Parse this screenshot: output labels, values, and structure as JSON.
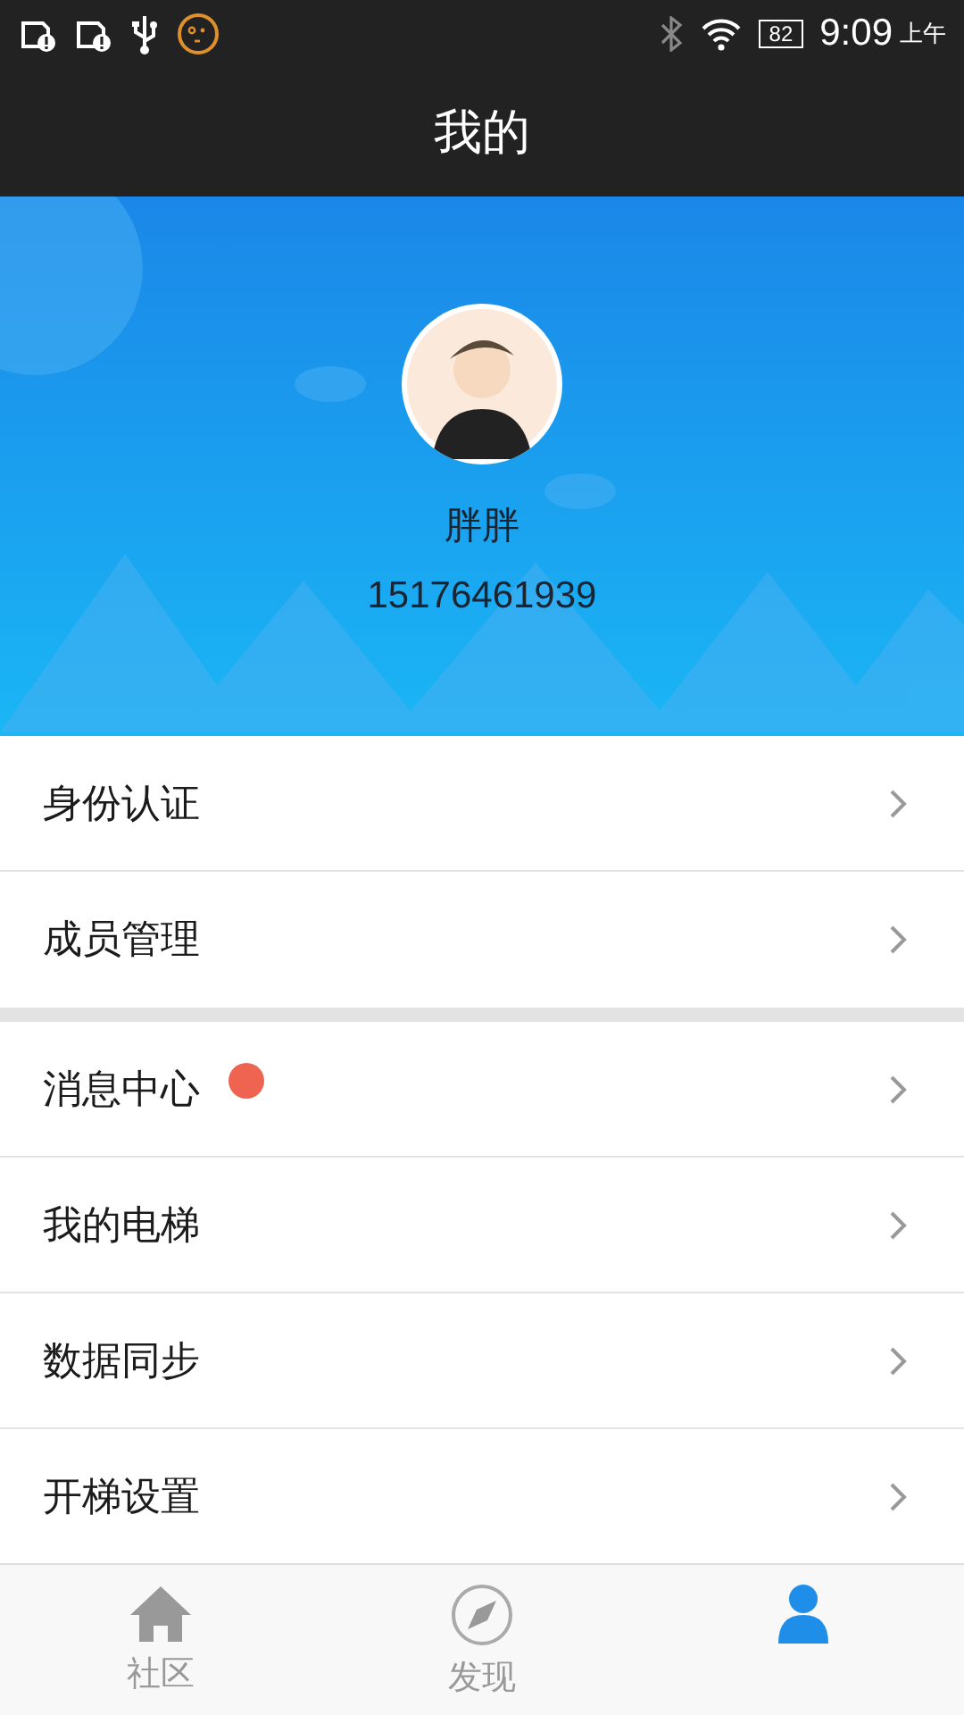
{
  "status_bar": {
    "battery": "82",
    "time": "9:09",
    "period": "上午"
  },
  "header": {
    "title": "我的"
  },
  "profile": {
    "name": "胖胖",
    "phone": "15176461939"
  },
  "menu_groups": [
    [
      {
        "label": "身份认证",
        "unread": false
      },
      {
        "label": "成员管理",
        "unread": false
      }
    ],
    [
      {
        "label": "消息中心",
        "unread": true
      },
      {
        "label": "我的电梯",
        "unread": false
      },
      {
        "label": "数据同步",
        "unread": false
      },
      {
        "label": "开梯设置",
        "unread": false
      }
    ]
  ],
  "tab_bar": [
    {
      "label": "社区",
      "kind": "home",
      "selected": false
    },
    {
      "label": "发现",
      "kind": "compass",
      "selected": false
    },
    {
      "kind": "person",
      "selected": true
    }
  ]
}
